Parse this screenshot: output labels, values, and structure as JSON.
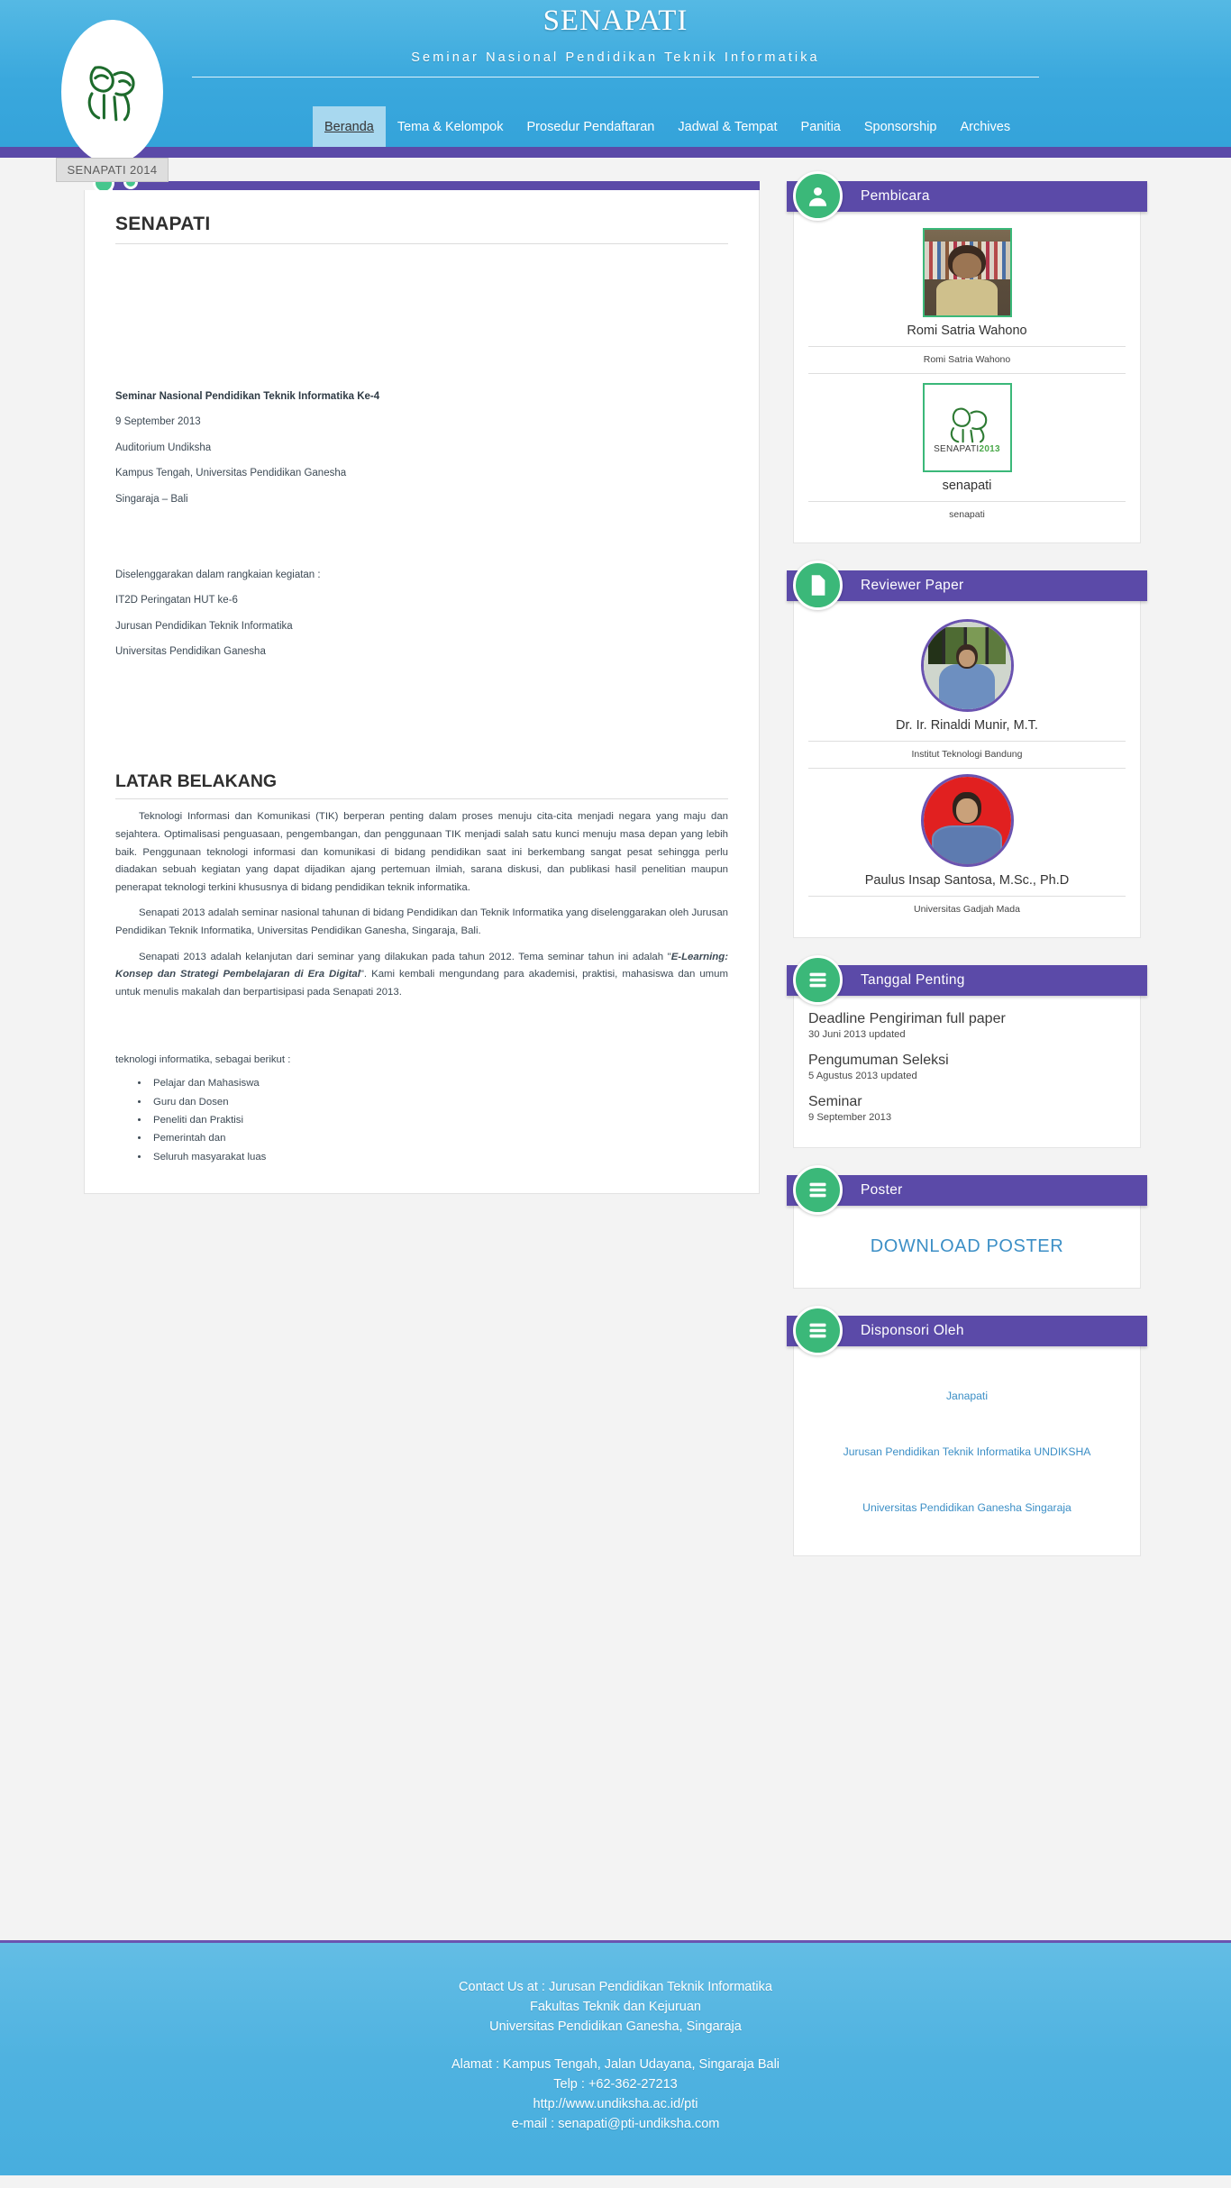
{
  "header": {
    "brand_title": "SENAPATI",
    "brand_subtitle": "Seminar Nasional Pendidikan Teknik Informatika",
    "logo_caption": "SENAPATI 2014",
    "logo_icon": "senapati-bull-logo",
    "nav": [
      {
        "label": "Beranda",
        "active": true
      },
      {
        "label": "Tema & Kelompok",
        "active": false
      },
      {
        "label": "Prosedur Pendaftaran",
        "active": false
      },
      {
        "label": "Jadwal & Tempat",
        "active": false
      },
      {
        "label": "Panitia",
        "active": false
      },
      {
        "label": "Sponsorship",
        "active": false
      },
      {
        "label": "Archives",
        "active": false
      }
    ]
  },
  "main": {
    "title": "SENAPATI",
    "event_meta": [
      "Seminar Nasional Pendidikan Teknik Informatika Ke-4",
      "9 September 2013",
      "Auditorium Undiksha",
      "Kampus Tengah, Universitas Pendidikan Ganesha",
      "Singaraja – Bali"
    ],
    "organized_meta": [
      "Diselenggarakan dalam rangkaian kegiatan :",
      "IT2D Peringatan HUT ke-6",
      "Jurusan Pendidikan Teknik Informatika",
      "Universitas Pendidikan Ganesha"
    ],
    "background_title": "LATAR BELAKANG",
    "paragraph_1": "Teknologi Informasi dan Komunikasi (TIK) berperan penting dalam proses menuju cita-cita menjadi negara yang maju dan sejahtera. Optimalisasi penguasaan, pengembangan, dan penggunaan TIK menjadi salah satu kunci menuju masa depan yang lebih baik. Penggunaan teknologi informasi dan komunikasi di bidang pendidikan saat ini berkembang sangat pesat sehingga perlu diadakan sebuah kegiatan yang dapat dijadikan ajang pertemuan ilmiah, sarana diskusi, dan publikasi hasil penelitian maupun penerapat teknologi terkini khususnya di bidang pendidikan teknik informatika.",
    "paragraph_2": "Senapati 2013 adalah seminar nasional tahunan di bidang Pendidikan dan Teknik Informatika yang diselenggarakan oleh Jurusan Pendidikan Teknik Informatika, Universitas Pendidikan Ganesha, Singaraja, Bali.",
    "paragraph_3_a": "Senapati 2013 adalah kelanjutan dari seminar yang dilakukan pada tahun 2012. Tema seminar tahun ini adalah \"",
    "paragraph_3_em": "E-Learning: Konsep dan Strategi Pembelajaran di Era Digital",
    "paragraph_3_b": "\". Kami kembali mengundang para akademisi, praktisi, mahasiswa dan umum untuk menulis makalah dan berpartisipasi pada Senapati 2013.",
    "clipped_line": "teknologi informatika, sebagai berikut :",
    "audience": [
      "Pelajar dan Mahasiswa",
      "Guru dan Dosen",
      "Peneliti dan Praktisi",
      "Pemerintah dan",
      "Seluruh masyarakat luas"
    ]
  },
  "sidebar": {
    "speakers": {
      "title": "Pembicara",
      "icon": "person-icon",
      "items": [
        {
          "name": "Romi Satria Wahono",
          "affiliation": "Romi Satria Wahono",
          "photo": "portrait-bookshelf"
        },
        {
          "name": "senapati",
          "affiliation": "senapati",
          "photo": "senapati-2013-logo"
        }
      ]
    },
    "reviewers": {
      "title": "Reviewer Paper",
      "icon": "document-icon",
      "items": [
        {
          "name": "Dr. Ir. Rinaldi Munir, M.T.",
          "affiliation": "Institut Teknologi Bandung",
          "photo": "portrait-window"
        },
        {
          "name": "Paulus Insap Santosa, M.Sc., Ph.D",
          "affiliation": "Universitas Gadjah Mada",
          "photo": "portrait-red"
        }
      ]
    },
    "dates": {
      "title": "Tanggal Penting",
      "icon": "list-icon",
      "items": [
        {
          "label": "Deadline Pengiriman full paper",
          "value": "30 Juni 2013 updated"
        },
        {
          "label": "Pengumuman Seleksi",
          "value": "5 Agustus 2013 updated"
        },
        {
          "label": "Seminar",
          "value": "9 September 2013"
        }
      ]
    },
    "poster": {
      "title": "Poster",
      "icon": "list-icon",
      "link_label": "DOWNLOAD POSTER"
    },
    "sponsors": {
      "title": "Disponsori Oleh",
      "icon": "list-icon",
      "items": [
        "Janapati",
        "Jurusan Pendidikan Teknik Informatika UNDIKSHA",
        "Universitas Pendidikan Ganesha Singaraja"
      ]
    }
  },
  "footer": {
    "lines_top": [
      "Contact Us at : Jurusan Pendidikan Teknik Informatika",
      "Fakultas Teknik dan Kejuruan",
      "Universitas Pendidikan Ganesha, Singaraja"
    ],
    "lines_bottom": [
      "Alamat : Kampus Tengah, Jalan Udayana, Singaraja Bali",
      "Telp : +62-362-27213",
      "http://www.undiksha.ac.id/pti",
      "e-mail : senapati@pti-undiksha.com"
    ]
  },
  "colors": {
    "header_blue": "#3aa8dd",
    "accent_purple": "#5b4aa8",
    "accent_green": "#3bb879",
    "link_blue": "#3c8fc6",
    "nav_active_bg": "#a8d8ef"
  }
}
